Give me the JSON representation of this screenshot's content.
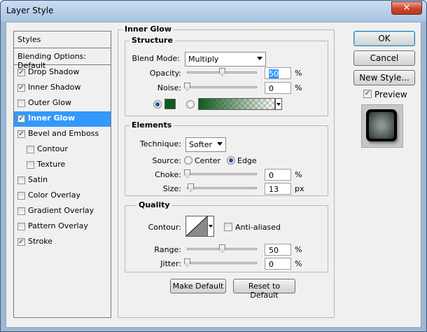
{
  "window": {
    "title": "Layer Style",
    "close_glyph": "✕"
  },
  "styles_panel": {
    "header": "Styles",
    "blending": "Blending Options: Default",
    "items": [
      {
        "label": "Drop Shadow",
        "checked": true,
        "indent": false,
        "selected": false
      },
      {
        "label": "Inner Shadow",
        "checked": true,
        "indent": false,
        "selected": false
      },
      {
        "label": "Outer Glow",
        "checked": false,
        "indent": false,
        "selected": false
      },
      {
        "label": "Inner Glow",
        "checked": true,
        "indent": false,
        "selected": true
      },
      {
        "label": "Bevel and Emboss",
        "checked": true,
        "indent": false,
        "selected": false
      },
      {
        "label": "Contour",
        "checked": false,
        "indent": true,
        "selected": false
      },
      {
        "label": "Texture",
        "checked": false,
        "indent": true,
        "selected": false
      },
      {
        "label": "Satin",
        "checked": false,
        "indent": false,
        "selected": false
      },
      {
        "label": "Color Overlay",
        "checked": false,
        "indent": false,
        "selected": false
      },
      {
        "label": "Gradient Overlay",
        "checked": false,
        "indent": false,
        "selected": false
      },
      {
        "label": "Pattern Overlay",
        "checked": false,
        "indent": false,
        "selected": false
      },
      {
        "label": "Stroke",
        "checked": true,
        "indent": false,
        "selected": false
      }
    ]
  },
  "inner_glow": {
    "title": "Inner Glow",
    "structure": {
      "title": "Structure",
      "blend_mode_label": "Blend Mode:",
      "blend_mode_value": "Multiply",
      "opacity_label": "Opacity:",
      "opacity_value": "50",
      "opacity_unit": "%",
      "opacity_level": 0.5,
      "noise_label": "Noise:",
      "noise_value": "0",
      "noise_unit": "%",
      "noise_level": 0,
      "glow_color": "#0f5a1f"
    },
    "elements": {
      "title": "Elements",
      "technique_label": "Technique:",
      "technique_value": "Softer",
      "source_label": "Source:",
      "source_center": "Center",
      "source_edge": "Edge",
      "choke_label": "Choke:",
      "choke_value": "0",
      "choke_unit": "%",
      "choke_level": 0,
      "size_label": "Size:",
      "size_value": "13",
      "size_unit": "px",
      "size_level": 0.052
    },
    "quality": {
      "title": "Quality",
      "contour_label": "Contour:",
      "anti_aliased_label": "Anti-aliased",
      "range_label": "Range:",
      "range_value": "50",
      "range_unit": "%",
      "range_level": 0.5,
      "jitter_label": "Jitter:",
      "jitter_value": "0",
      "jitter_unit": "%",
      "jitter_level": 0
    },
    "make_default": "Make Default",
    "reset_default": "Reset to Default"
  },
  "actions": {
    "ok": "OK",
    "cancel": "Cancel",
    "new_style": "New Style...",
    "preview_label": "Preview",
    "check_glyph": "✓"
  }
}
